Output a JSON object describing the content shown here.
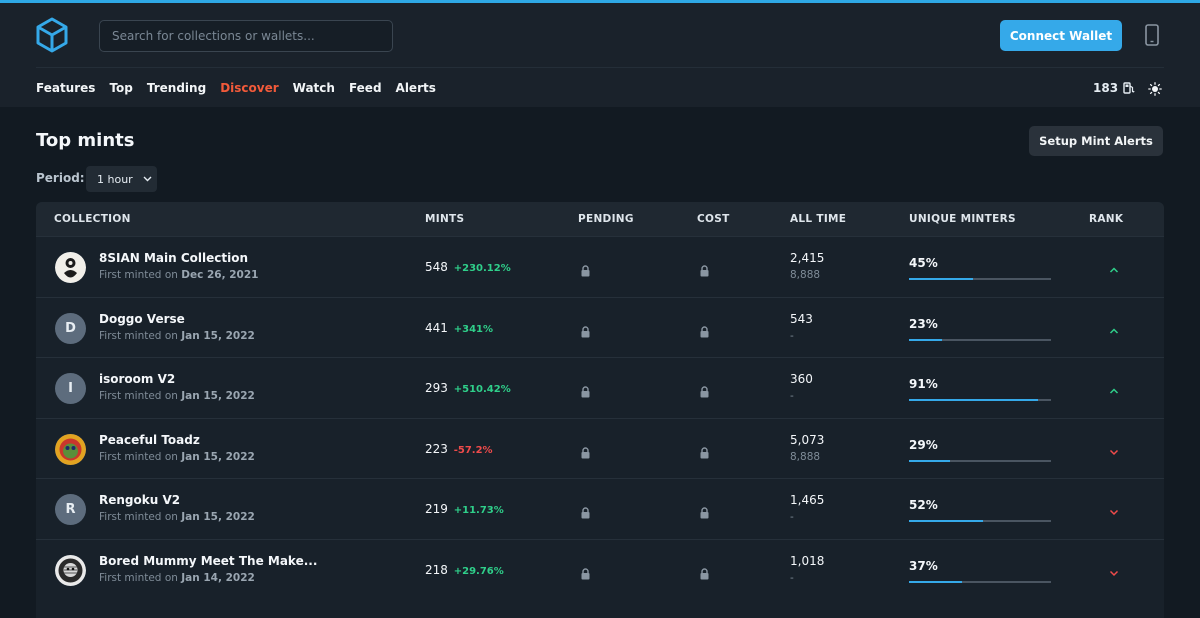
{
  "header": {
    "search_placeholder": "Search for collections or wallets...",
    "connect_label": "Connect Wallet",
    "gas_value": "183"
  },
  "nav": [
    {
      "label": "Features",
      "active": false
    },
    {
      "label": "Top",
      "active": false
    },
    {
      "label": "Trending",
      "active": false
    },
    {
      "label": "Discover",
      "active": true
    },
    {
      "label": "Watch",
      "active": false
    },
    {
      "label": "Feed",
      "active": false
    },
    {
      "label": "Alerts",
      "active": false
    }
  ],
  "page": {
    "title": "Top mints",
    "setup_label": "Setup Mint Alerts",
    "period_label": "Period:",
    "period_value": "1 hour"
  },
  "table": {
    "columns": [
      "COLLECTION",
      "MINTS",
      "PENDING",
      "COST",
      "ALL TIME",
      "UNIQUE MINTERS",
      "RANK"
    ],
    "first_minted_prefix": "First minted on",
    "rows": [
      {
        "name": "8SIAN Main Collection",
        "date": "Dec 26, 2021",
        "avatar": "",
        "avatar_type": "image-8sian",
        "mints": "548",
        "change": "+230.12%",
        "direction": "up",
        "all_time": "2,415",
        "supply": "8,888",
        "unique_pct": "45%",
        "unique_fraction": 0.45,
        "rank": "up"
      },
      {
        "name": "Doggo Verse",
        "date": "Jan 15, 2022",
        "avatar": "D",
        "avatar_type": "letter",
        "mints": "441",
        "change": "+341%",
        "direction": "up",
        "all_time": "543",
        "supply": "-",
        "unique_pct": "23%",
        "unique_fraction": 0.23,
        "rank": "up"
      },
      {
        "name": "isoroom V2",
        "date": "Jan 15, 2022",
        "avatar": "I",
        "avatar_type": "letter",
        "mints": "293",
        "change": "+510.42%",
        "direction": "up",
        "all_time": "360",
        "supply": "-",
        "unique_pct": "91%",
        "unique_fraction": 0.91,
        "rank": "up"
      },
      {
        "name": "Peaceful Toadz",
        "date": "Jan 15, 2022",
        "avatar": "",
        "avatar_type": "image-toadz",
        "mints": "223",
        "change": "-57.2%",
        "direction": "down",
        "all_time": "5,073",
        "supply": "8,888",
        "unique_pct": "29%",
        "unique_fraction": 0.29,
        "rank": "down"
      },
      {
        "name": "Rengoku V2",
        "date": "Jan 15, 2022",
        "avatar": "R",
        "avatar_type": "letter",
        "mints": "219",
        "change": "+11.73%",
        "direction": "up",
        "all_time": "1,465",
        "supply": "-",
        "unique_pct": "52%",
        "unique_fraction": 0.52,
        "rank": "down"
      },
      {
        "name": "Bored Mummy Meet The Make...",
        "date": "Jan 14, 2022",
        "avatar": "",
        "avatar_type": "image-mummy",
        "mints": "218",
        "change": "+29.76%",
        "direction": "up",
        "all_time": "1,018",
        "supply": "-",
        "unique_pct": "37%",
        "unique_fraction": 0.37,
        "rank": "down"
      }
    ]
  },
  "colors": {
    "accent": "#35a9e9",
    "active_nav": "#f25a3a",
    "up": "#2fcf8a",
    "down": "#ef4b4b"
  },
  "icons": [
    "cube-logo-icon",
    "mobile-icon",
    "gas-pump-icon",
    "sun-icon",
    "chevron-down-icon",
    "lock-icon",
    "rank-up-icon",
    "rank-down-icon"
  ]
}
